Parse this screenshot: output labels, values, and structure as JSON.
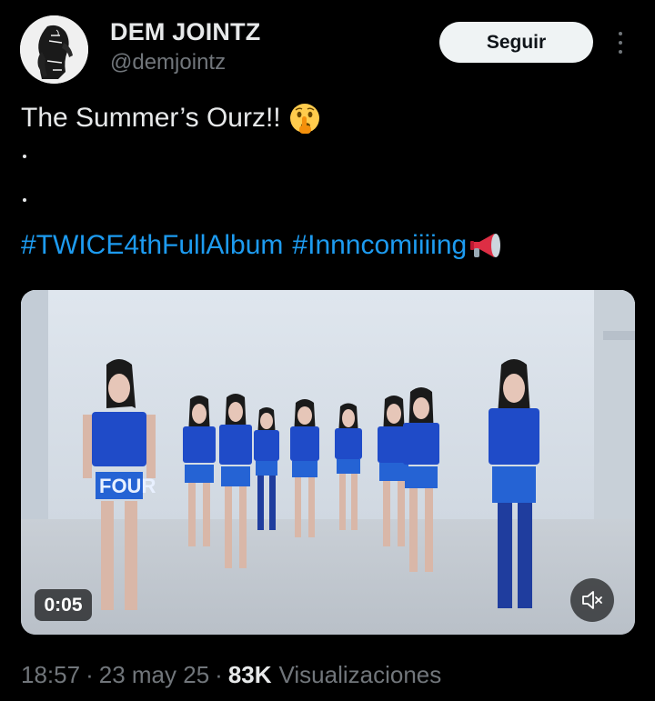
{
  "author": {
    "display_name": "DEM JOINTZ",
    "handle": "@demjointz",
    "avatar_icon": "avatar-sketch"
  },
  "actions": {
    "follow_label": "Seguir",
    "more_icon": "more-vertical-icon"
  },
  "tweet": {
    "text": "The Summer’s Ourz!!",
    "emoji": "shushing-face-emoji",
    "dots": [
      ".",
      "."
    ],
    "hashtags": [
      "#TWICE4thFullAlbum",
      "#Innncomiiiing"
    ],
    "trailing_emoji": "megaphone-emoji"
  },
  "media": {
    "type": "video",
    "duration": "0:05",
    "mute_icon": "speaker-muted-icon"
  },
  "meta": {
    "time": "18:57",
    "date": "23 may 25",
    "views_count": "83K",
    "views_label": "Visualizaciones",
    "separator": "·"
  },
  "colors": {
    "background": "#000000",
    "text": "#e7e9ea",
    "secondary": "#71767b",
    "link": "#1d9bf0",
    "button_bg": "#eff3f4"
  }
}
